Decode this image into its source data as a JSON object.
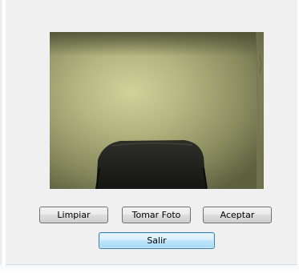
{
  "camera": {
    "description_icon": "webcam-preview"
  },
  "buttons": {
    "clear_label": "Limpiar",
    "capture_label": "Tomar Foto",
    "accept_label": "Aceptar",
    "exit_label": "Salir"
  },
  "colors": {
    "dialog_background": "#f0f0f0",
    "button_border": "#707070",
    "default_button_border": "#3c7fb1"
  }
}
